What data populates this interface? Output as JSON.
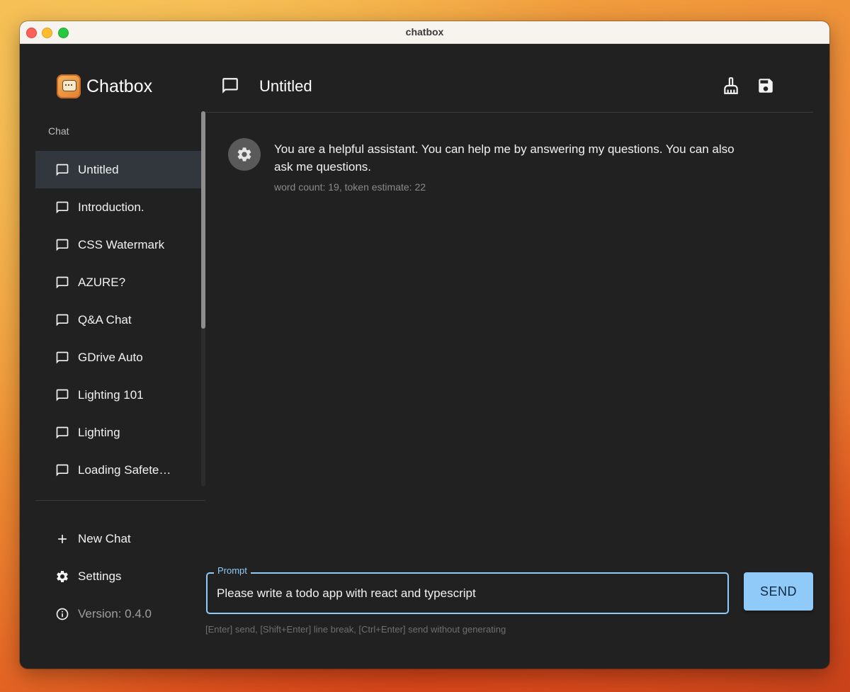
{
  "window": {
    "title": "chatbox"
  },
  "brand": {
    "name": "Chatbox",
    "logo_icon": "chatbox-logo-icon"
  },
  "sidebar": {
    "section_label": "Chat",
    "items": [
      {
        "label": "Untitled",
        "icon": "chat-bubble-icon",
        "active": true
      },
      {
        "label": "Introduction.",
        "icon": "chat-bubble-icon"
      },
      {
        "label": "CSS Watermark",
        "icon": "chat-bubble-icon"
      },
      {
        "label": "AZURE?",
        "icon": "chat-bubble-icon"
      },
      {
        "label": "Q&A Chat",
        "icon": "chat-bubble-icon"
      },
      {
        "label": "GDrive Auto",
        "icon": "chat-bubble-icon"
      },
      {
        "label": "Lighting 101",
        "icon": "chat-bubble-icon"
      },
      {
        "label": "Lighting",
        "icon": "chat-bubble-icon"
      },
      {
        "label": "Loading Safete…",
        "icon": "chat-bubble-icon"
      }
    ],
    "new_chat_label": "New Chat",
    "settings_label": "Settings",
    "version_label": "Version: 0.4.0"
  },
  "header": {
    "title": "Untitled",
    "clean_icon": "broom-icon",
    "save_icon": "save-icon"
  },
  "messages": [
    {
      "role_icon": "gear-icon",
      "text": "You are a helpful assistant. You can help me by answering my questions. You can also ask me questions.",
      "meta": "word count: 19, token estimate: 22"
    }
  ],
  "input": {
    "legend": "Prompt",
    "value": "Please write a todo app with react and typescript",
    "send_label": "SEND",
    "hint": "[Enter] send, [Shift+Enter] line break, [Ctrl+Enter] send without generating"
  },
  "colors": {
    "background": "#212121",
    "accent": "#90caf9",
    "active_item": "#32373d"
  }
}
